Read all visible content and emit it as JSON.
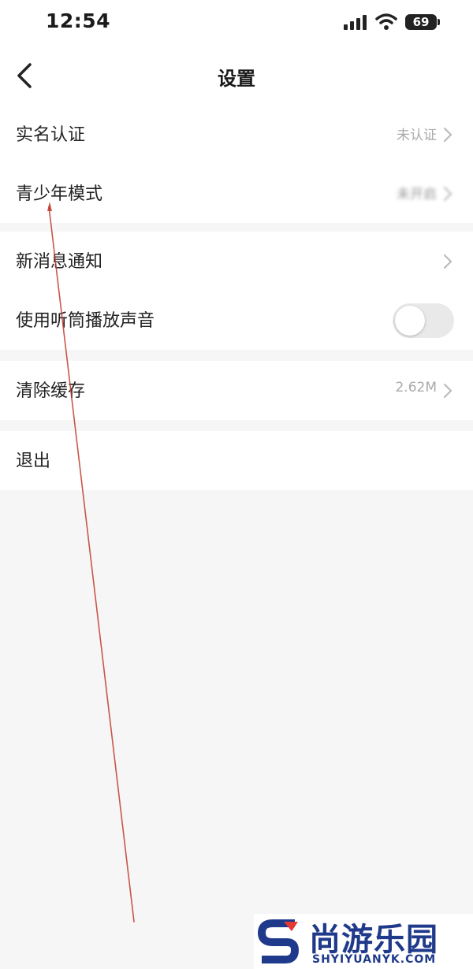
{
  "status_bar": {
    "time": "12:54",
    "battery": "69"
  },
  "header": {
    "title": "设置",
    "back_icon": "chevron-left-icon"
  },
  "sections": [
    {
      "rows": [
        {
          "label": "实名认证",
          "value": "未认证",
          "has_chevron": true
        },
        {
          "label": "青少年模式",
          "value": "未开启",
          "has_chevron": true
        }
      ]
    },
    {
      "rows": [
        {
          "label": "新消息通知",
          "has_chevron": true
        },
        {
          "label": "使用听筒播放声音",
          "toggle_on": false
        }
      ]
    },
    {
      "rows": [
        {
          "label": "清除缓存",
          "value": "2.62M",
          "has_chevron": true
        }
      ]
    },
    {
      "rows": [
        {
          "label": "退出"
        }
      ]
    }
  ],
  "watermark": {
    "title": "尚游乐园",
    "subtitle": "SHYIYUANYK.COM",
    "logo_icon": "s-logo-icon"
  },
  "colors": {
    "annotation_line": "#c0392b",
    "toggle_off": "#e9e9ea",
    "watermark_blue": "#1f3a8a",
    "watermark_red": "#e53935"
  }
}
